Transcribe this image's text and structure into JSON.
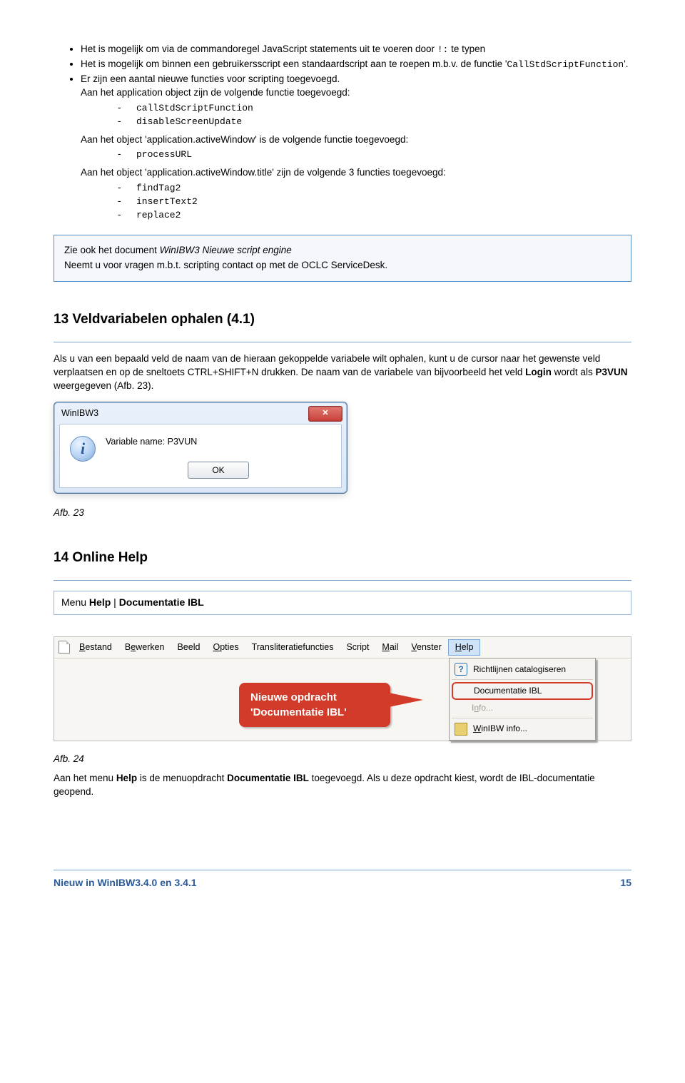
{
  "bullets": {
    "b1a": "Het is mogelijk om via de commandoregel JavaScript statements uit te voeren door ",
    "b1code": "!:",
    "b1b": " te typen",
    "b2a": "Het is mogelijk om binnen een gebruikersscript een standaardscript aan te roepen m.b.v. de functie '",
    "b2code": "CallStdScriptFunction",
    "b2b": "'.",
    "b3": "Er zijn een aantal nieuwe functies voor scripting toegevoegd.",
    "b3line": "Aan het application object zijn de volgende functie toegevoegd:",
    "b3s1": "callStdScriptFunction",
    "b3s2": "disableScreenUpdate",
    "b3line2": "Aan het object 'application.activeWindow' is de volgende functie toegevoegd:",
    "b3s3": "processURL",
    "b3line3": "Aan het object 'application.activeWindow.title' zijn de volgende 3 functies toegevoegd:",
    "b3s4": "findTag2",
    "b3s5": "insertText2",
    "b3s6": "replace2"
  },
  "note": {
    "l1a": "Zie ook het document ",
    "l1i": "WinIBW3 Nieuwe script engine",
    "l2": "Neemt u voor vragen m.b.t. scripting contact op met de OCLC ServiceDesk."
  },
  "h13": "13 Veldvariabelen ophalen (4.1)",
  "p13a": "Als u van een bepaald veld de naam van de hieraan gekoppelde variabele wilt ophalen, kunt u de cursor naar het gewenste veld verplaatsen en op de sneltoets C",
  "p13key1": "TRL",
  "p13plus": "+S",
  "p13key2": "HIFT",
  "p13b": "+N drukken. De naam van de variabele van bijvoorbeeld het veld ",
  "p13login": "Login",
  "p13c": " wordt als ",
  "p13var": "P3VUN",
  "p13d": " weergegeven (Afb. 23).",
  "dialog": {
    "title": "WinIBW3",
    "msg": "Variable name: P3VUN",
    "ok": "OK"
  },
  "afb23": "Afb. 23",
  "h14": "14 Online Help",
  "menuline_a": "Menu ",
  "menuline_b": "Help",
  "menuline_c": " | ",
  "menuline_d": "Documentatie IBL",
  "menubar": {
    "m0": "Bestand",
    "m1": "Bewerken",
    "m2": "Beeld",
    "m3": "Opties",
    "m4": "Transliteratiefuncties",
    "m5": "Script",
    "m6": "Mail",
    "m7": "Venster",
    "m8": "Help"
  },
  "dropdown": {
    "d0": "Richtlijnen catalogiseren",
    "d1": "Documentatie IBL",
    "d2": "Info...",
    "d3": "WinIBW info..."
  },
  "callout": {
    "l1": "Nieuwe opdracht",
    "l2": "'Documentatie IBL'"
  },
  "afb24": "Afb. 24",
  "p14a": "Aan het menu ",
  "p14b": "Help",
  "p14c": " is de menuopdracht ",
  "p14d": "Documentatie IBL",
  "p14e": " toegevoegd. Als u deze opdracht kiest, wordt de IBL-documentatie geopend.",
  "footer": {
    "left": "Nieuw in WinIBW3.4.0 en 3.4.1",
    "right": "15"
  }
}
